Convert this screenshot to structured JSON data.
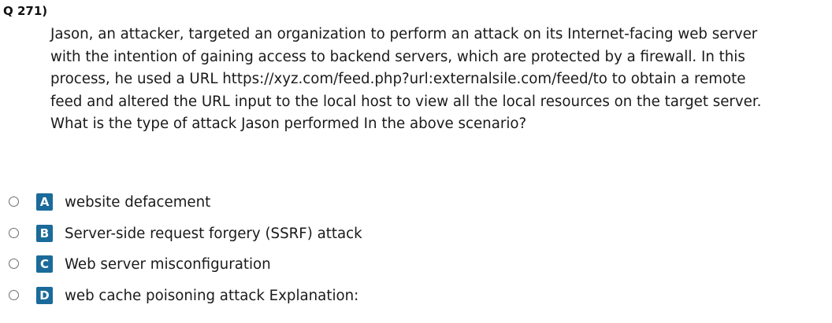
{
  "question": {
    "number": "Q 271)",
    "lines": [
      "Jason, an attacker, targeted an organization to perform an attack on its Internet-facing web server",
      "with the intention of gaining access to backend servers, which are protected by a firewall. In this",
      "process, he used a URL https://xyz.com/feed.php?url:externalsile.com/feed/to to obtain a remote",
      "feed and altered the URL input to the local host to view all the local resources on the target server.",
      "What is the type of attack Jason performed In the above scenario?"
    ]
  },
  "options": [
    {
      "letter": "A",
      "text": "website defacement"
    },
    {
      "letter": "B",
      "text": "Server-side request forgery (SSRF) attack"
    },
    {
      "letter": "C",
      "text": "Web server misconfiguration"
    },
    {
      "letter": "D",
      "text": "web cache poisoning attack Explanation:"
    }
  ],
  "colors": {
    "badge": "#1a6b9a",
    "text": "#1a1a1a"
  }
}
